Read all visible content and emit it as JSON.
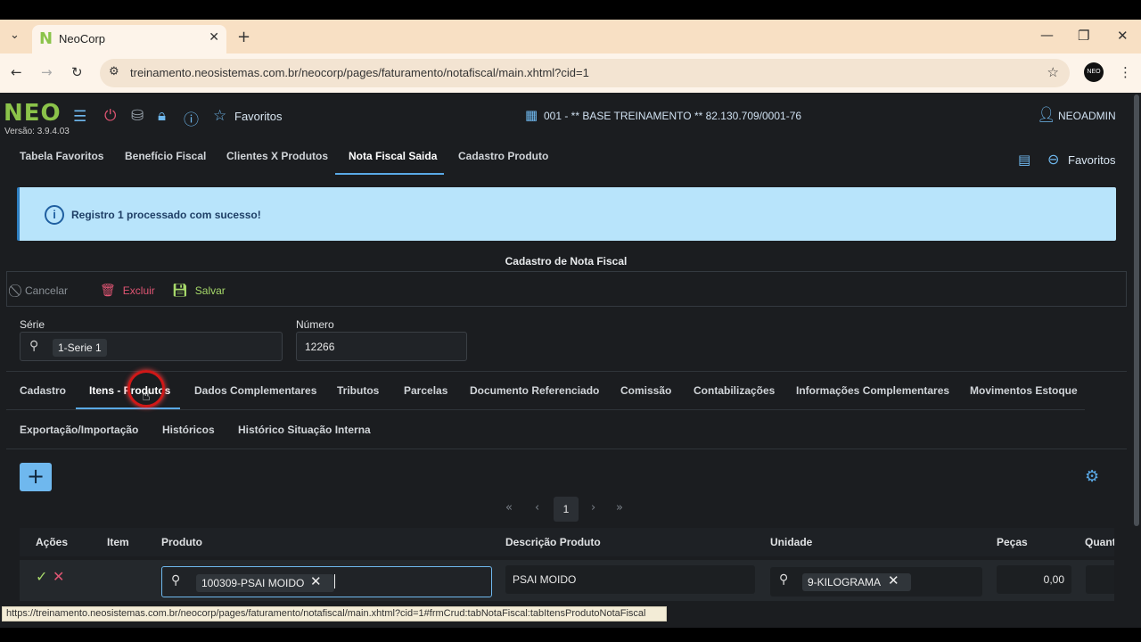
{
  "browser": {
    "tab_title": "NeoCorp",
    "tab_favicon": "N",
    "url": "treinamento.neosistemas.com.br/neocorp/pages/faturamento/notafiscal/main.xhtml?cid=1",
    "profile": "NEO"
  },
  "header": {
    "logo": "NEO",
    "version": "Versão: 3.9.4.03",
    "favorites_label": "Favoritos",
    "company": "001 - ** BASE TREINAMENTO ** 82.130.709/0001-76",
    "user": "NEOADMIN"
  },
  "page_tabs": [
    "Tabela Favoritos",
    "Benefício Fiscal",
    "Clientes X Produtos",
    "Nota Fiscal Saida",
    "Cadastro Produto"
  ],
  "page_tabs_active": "Nota Fiscal Saida",
  "page_favorites_label": "Favoritos",
  "message": {
    "text": "Registro 1 processado com sucesso!",
    "color": "#b8e4fb"
  },
  "form": {
    "title": "Cadastro de Nota Fiscal",
    "toolbar": {
      "cancel": "Cancelar",
      "delete": "Excluir",
      "save": "Salvar"
    },
    "serie_label": "Série",
    "serie_value": "1-Serie 1",
    "numero_label": "Número",
    "numero_value": "12266"
  },
  "form_tabs_row1": [
    "Cadastro",
    "Itens - Produtos",
    "Dados Complementares",
    "Tributos",
    "Parcelas",
    "Documento Referenciado",
    "Comissão",
    "Contabilizações",
    "Informações Complementares",
    "Movimentos Estoque"
  ],
  "form_tabs_row2": [
    "Exportação/Importação",
    "Históricos",
    "Histórico Situação Interna"
  ],
  "form_tabs_active": "Itens - Produtos",
  "pagination": {
    "current": "1"
  },
  "table": {
    "headers": [
      "Ações",
      "Item",
      "Produto",
      "Descrição Produto",
      "Unidade",
      "Peças",
      "Quant"
    ],
    "row": {
      "produto": "100309-PSAI MOIDO",
      "descricao": "PSAI MOIDO",
      "unidade": "9-KILOGRAMA",
      "pecas": "0,00"
    }
  },
  "status_url": "https://treinamento.neosistemas.com.br/neocorp/pages/faturamento/notafiscal/main.xhtml?cid=1#frmCrud:tabNotaFiscal:tabItensProdutoNotaFiscal",
  "colors": {
    "accent": "#5aa9e6",
    "logo": "#8bc34a",
    "danger": "#e05573",
    "save": "#a6d86a"
  }
}
